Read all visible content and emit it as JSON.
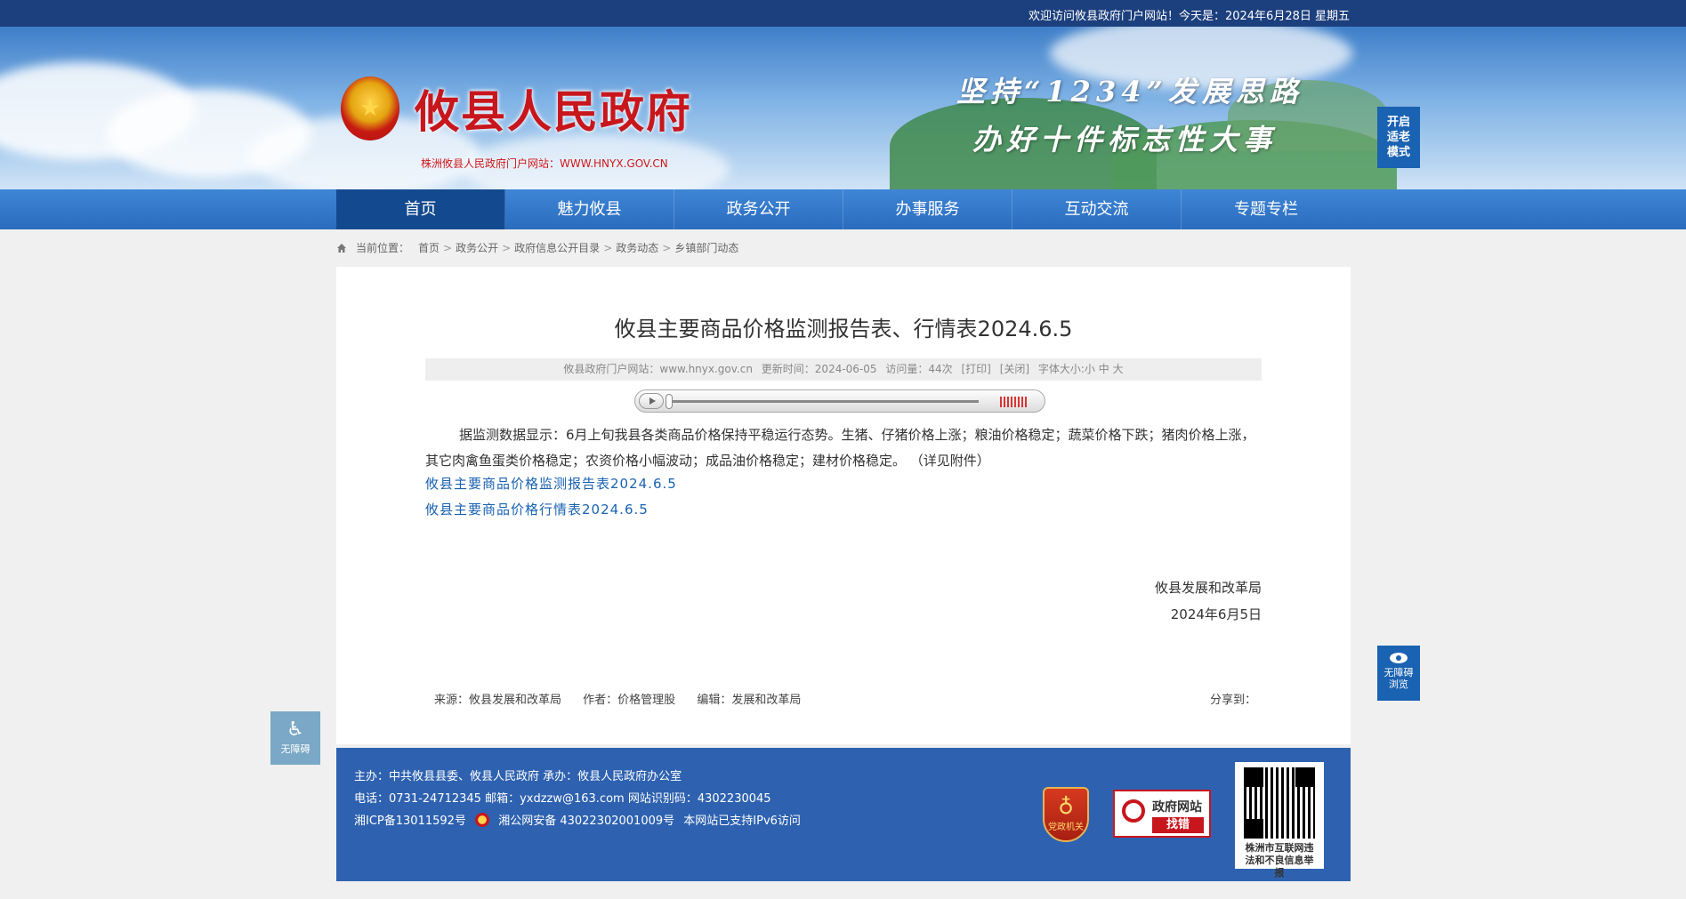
{
  "topbar": {
    "welcome": "欢迎访问攸县政府门户网站！今天是：2024年6月28日 星期五"
  },
  "header": {
    "site_title": "攸县人民政府",
    "site_subtitle": "株洲攸县人民政府门户网站：WWW.HNYX.GOV.CN",
    "slogan_line1": "坚持“1234”发展思路",
    "slogan_line2": "办好十件标志性大事",
    "elder_mode_label": "开启适老模式"
  },
  "nav": {
    "items": [
      {
        "label": "首页"
      },
      {
        "label": "魅力攸县"
      },
      {
        "label": "政务公开"
      },
      {
        "label": "办事服务"
      },
      {
        "label": "互动交流"
      },
      {
        "label": "专题专栏"
      }
    ]
  },
  "breadcrumb": {
    "prefix": "当前位置：",
    "items": [
      "首页",
      "政务公开",
      "政府信息公开目录",
      "政务动态",
      "乡镇部门动态"
    ],
    "separator": ">"
  },
  "article": {
    "title": "攸县主要商品价格监测报告表、行情表2024.6.5",
    "meta": {
      "site": "攸县政府门户网站：www.hnyx.gov.cn",
      "updated": "更新时间：2024-06-05",
      "visits": "访问量：44次",
      "print": "[打印]",
      "close": "[关闭]",
      "font_size": "字体大小:小 中 大"
    },
    "body": "据监测数据显示：6月上旬我县各类商品价格保持平稳运行态势。生猪、仔猪价格上涨；粮油价格稳定；蔬菜价格下跌；猪肉价格上涨，其它肉禽鱼蛋类价格稳定；农资价格小幅波动；成品油价格稳定；建材价格稳定。 （详见附件）",
    "attachments": [
      "攸县主要商品价格监测报告表2024.6.5",
      "攸县主要商品价格行情表2024.6.5"
    ],
    "signature_org": "攸县发展和改革局",
    "signature_date": "2024年6月5日",
    "source": "来源：攸县发展和改革局",
    "author": "作者：价格管理股",
    "editor": "编辑：发展和改革局",
    "share": "分享到："
  },
  "footer": {
    "line1": "主办：中共攸县县委、攸县人民政府 承办：攸县人民政府办公室",
    "line2": "电话：0731-24712345  邮箱：yxdzzw@163.com  网站识别码：4302230045",
    "icp": "湘ICP备13011592号",
    "police": "湘公网安备 43022302001009号",
    "ipv6": "本网站已支持IPv6访问",
    "badge_party_label": "党政机关",
    "error_badge_title": "政府网站",
    "error_badge_action": "找错",
    "qr_caption": "株洲市互联网违法和不良信息举报"
  },
  "floating": {
    "accessibility_label": "无障碍",
    "barrier_free_browse": "无障碍浏览"
  }
}
